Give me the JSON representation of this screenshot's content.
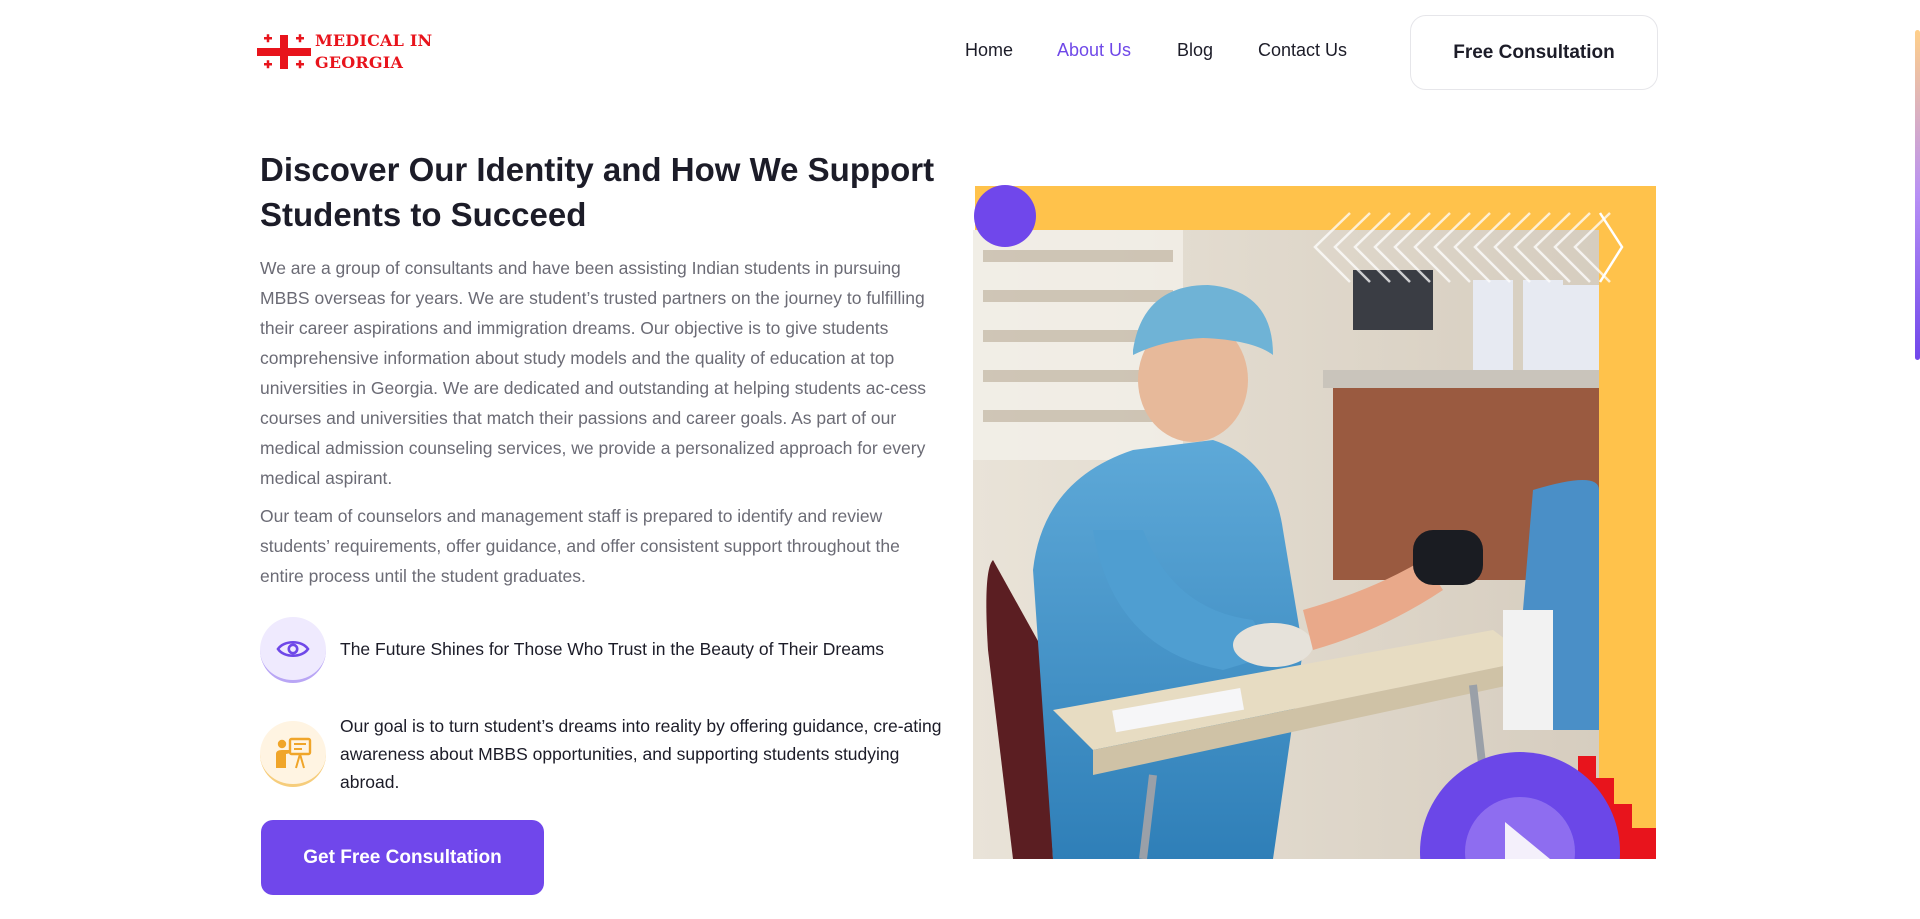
{
  "brand": {
    "line1": "MEDICAL IN",
    "line2": "GEORGIA",
    "color": "#e8141c"
  },
  "nav": {
    "items": [
      {
        "label": "Home",
        "active": false
      },
      {
        "label": "About Us",
        "active": true
      },
      {
        "label": "Blog",
        "active": false
      },
      {
        "label": "Contact Us",
        "active": false
      }
    ],
    "cta_label": "Free Consultation"
  },
  "about": {
    "title": "Discover Our Identity and How We Support Students to Succeed",
    "paragraph1": "We are a group of consultants and have been assisting Indian students in pursuing MBBS overseas for years. We are student’s trusted partners on the journey to fulfilling their career aspirations and immigration dreams. Our objective is to give students comprehensive information about study models and the quality of education at top universities in Georgia. We are dedicated and outstanding at helping students ac-cess courses and universities that match their passions and career goals. As part of our medical admission counseling services, we provide a personalized approach for every medical aspirant.",
    "paragraph2": "Our team of counselors and management staff is prepared to identify and review students’ requirements, offer guidance, and offer consistent support throughout the entire process until the student graduates.",
    "features": [
      {
        "icon": "eye-icon",
        "text": "The Future Shines for Those Who Trust in the Beauty of Their Dreams"
      },
      {
        "icon": "teacher-board-icon",
        "text": "Our goal is to turn student’s dreams into reality by offering guidance, cre-ating awareness about MBBS opportunities, and supporting students studying abroad."
      }
    ],
    "cta_label": "Get Free Consultation"
  },
  "colors": {
    "accent": "#7047eb",
    "yellow": "#ffc24b",
    "brand_red": "#e8141c"
  }
}
